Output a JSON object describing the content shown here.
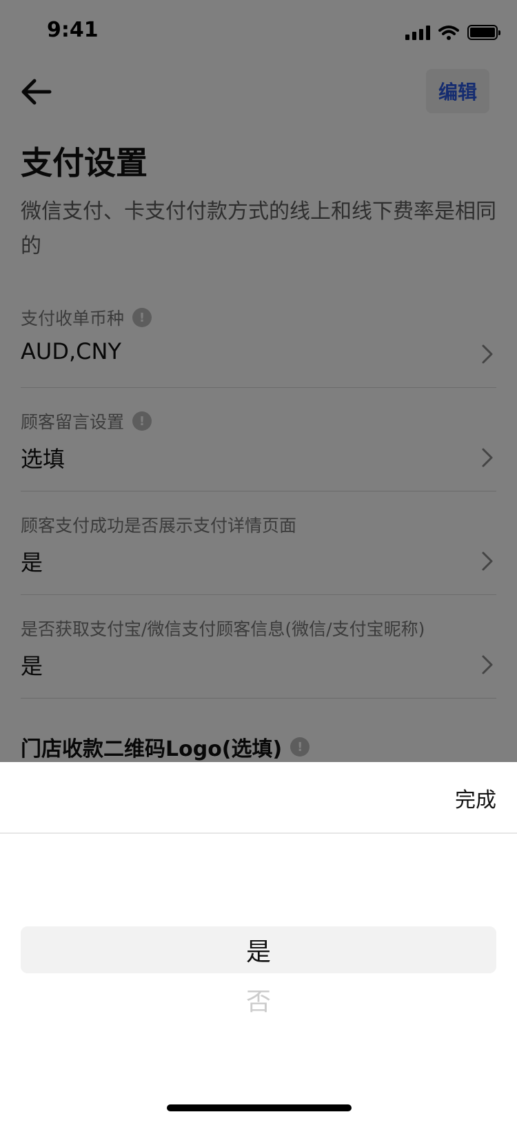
{
  "status_bar": {
    "time": "9:41",
    "signal_icon": "cellular-signal-icon",
    "wifi_icon": "wifi-icon",
    "battery_icon": "battery-icon"
  },
  "nav": {
    "back_icon": "arrow-left-icon",
    "edit_label": "编辑"
  },
  "page": {
    "title": "支付设置",
    "description": "微信支付、卡支付付款方式的线上和线下费率是相同的"
  },
  "settings": [
    {
      "label": "支付收单币种",
      "value": "AUD,CNY",
      "has_info": true
    },
    {
      "label": "顾客留言设置",
      "value": "选填",
      "has_info": true
    },
    {
      "label": "顾客支付成功是否展示支付详情页面",
      "value": "是",
      "has_info": false
    },
    {
      "label": "是否获取支付宝/微信支付顾客信息(微信/支付宝昵称)",
      "value": "是",
      "has_info": false
    }
  ],
  "section": {
    "title": "门店收款二维码Logo(选填)"
  },
  "picker": {
    "done_label": "完成",
    "options": [
      "是",
      "否"
    ],
    "selected": "是"
  },
  "colors": {
    "accent": "#2a58e0",
    "overlay": "rgba(0,0,0,0.5)"
  }
}
